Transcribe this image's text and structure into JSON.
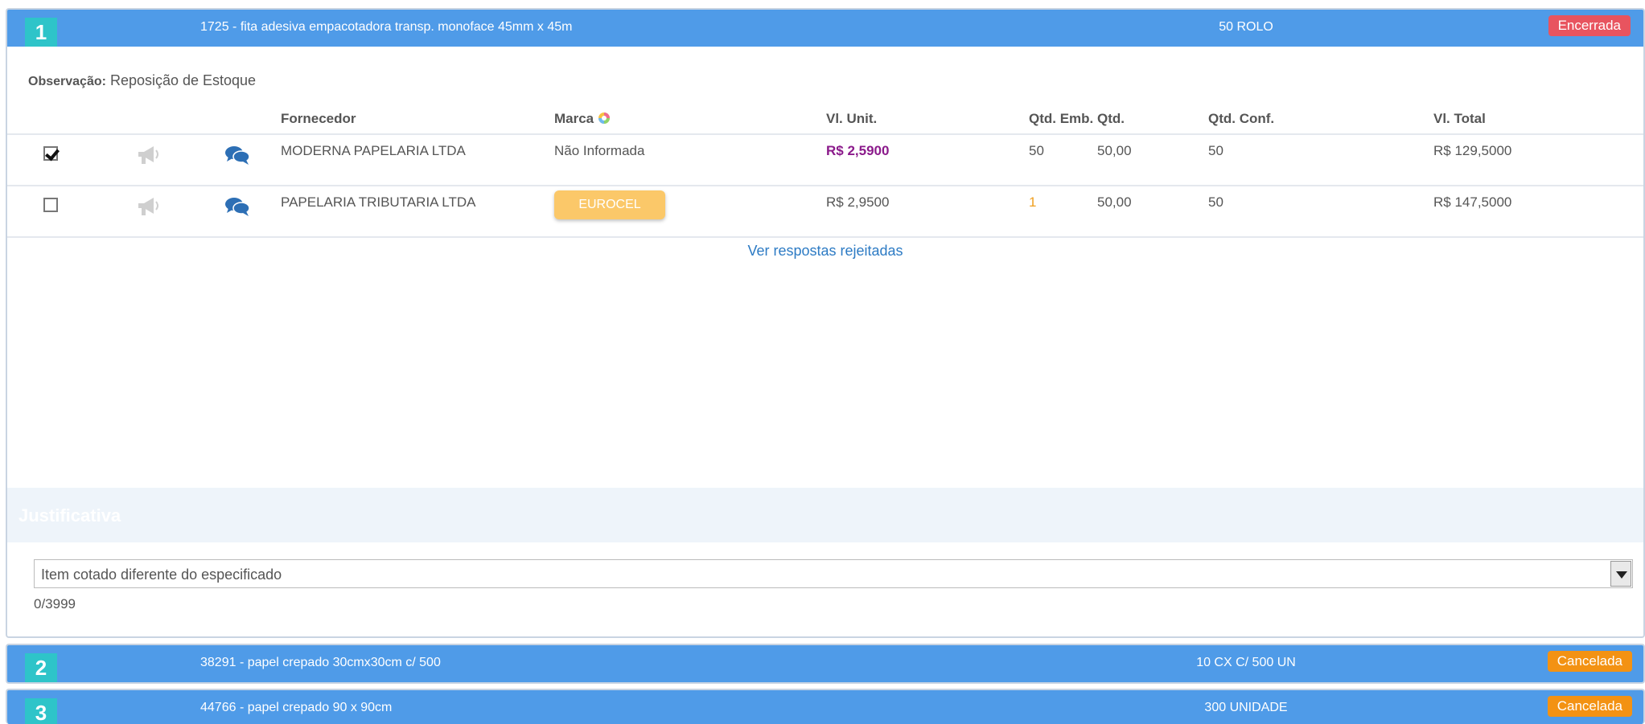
{
  "items": [
    {
      "number": "1",
      "title": "1725 - fita adesiva empacotadora transp. monoface 45mm x 45m",
      "quantity": "50 ROLO",
      "status": "Encerrada",
      "observation_label": "Observação:",
      "observation_text": " Reposição de Estoque",
      "columns": {
        "fornecedor": "Fornecedor",
        "marca": "Marca",
        "vl_unit": "Vl. Unit.",
        "qtd_emb": "Qtd. Emb.",
        "qtd": "Qtd.",
        "qtd_conf": "Qtd. Conf.",
        "vl_total": "Vl. Total"
      },
      "rows": [
        {
          "checked": true,
          "fornecedor": "MODERNA PAPELARIA LTDA",
          "marca": "Não Informada",
          "vl_unit": "R$ 2,5900",
          "qtd_emb": "50",
          "qtd": "50,00",
          "qtd_conf": "50",
          "vl_total": "R$ 129,5000"
        },
        {
          "checked": false,
          "fornecedor": "PAPELARIA TRIBUTARIA LTDA",
          "marca": "EUROCEL",
          "vl_unit": "R$ 2,9500",
          "qtd_emb": "1",
          "qtd": "50,00",
          "qtd_conf": "50",
          "vl_total": "R$ 147,5000"
        }
      ],
      "link_text": "Ver respostas rejeitadas",
      "justificativa_title": "Justificativa",
      "justificativa_value": "Item cotado diferente do especificado",
      "char_counter": "0/3999"
    },
    {
      "number": "2",
      "title": "38291 - papel crepado 30cmx30cm c/ 500",
      "quantity": "10 CX C/ 500 UN",
      "status": "Cancelada"
    },
    {
      "number": "3",
      "title": "44766 - papel crepado 90 x 90cm",
      "quantity": "300 UNIDADE",
      "status": "Cancelada"
    }
  ],
  "colors": {
    "header_blue": "#4f9be8",
    "number_teal": "#2ec4c9",
    "status_red": "#e8545f",
    "status_orange": "#f39213",
    "best_price_purple": "#8b1a8b",
    "qty_orange": "#f0a020",
    "link_blue": "#2d7bc4",
    "brand_button": "#fbc869"
  },
  "icons": [
    "megaphone-icon",
    "chat-bubbles-icon",
    "color-wheel-icon",
    "dropdown-arrow-icon"
  ]
}
